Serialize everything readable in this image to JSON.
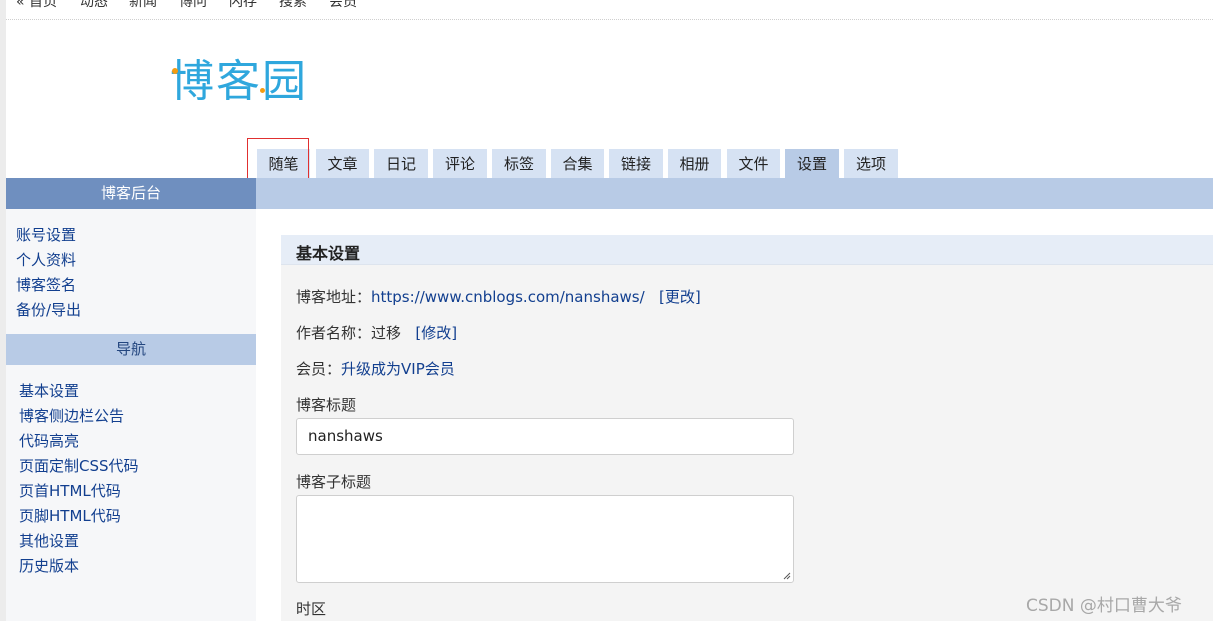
{
  "topnav": {
    "items": [
      "« 首页",
      "动态",
      "新闻",
      "博问",
      "闪存",
      "搜索",
      "会员"
    ]
  },
  "logo": {
    "text": "博客园"
  },
  "tabs": [
    "随笔",
    "文章",
    "日记",
    "评论",
    "标签",
    "合集",
    "链接",
    "相册",
    "文件",
    "设置",
    "选项"
  ],
  "active_tab": "设置",
  "sidebar": {
    "title": "博客后台",
    "account_links": [
      "账号设置",
      "个人资料",
      "博客签名",
      "备份/导出"
    ],
    "nav_title": "导航",
    "nav_links": [
      "基本设置",
      "博客侧边栏公告",
      "代码高亮",
      "页面定制CSS代码",
      "页首HTML代码",
      "页脚HTML代码",
      "其他设置",
      "历史版本"
    ]
  },
  "main": {
    "section_title": "基本设置",
    "blog_url_label": "博客地址：",
    "blog_url": "https://www.cnblogs.com/nanshaws/",
    "change_link": "[更改]",
    "author_label": "作者名称：",
    "author_name": "过移",
    "modify_link": "[修改]",
    "member_label": "会员：",
    "member_link": "升级成为VIP会员",
    "title_label": "博客标题",
    "title_value": "nanshaws",
    "subtitle_label": "博客子标题",
    "subtitle_value": "",
    "timezone_label": "时区"
  },
  "watermark": "CSDN @村口曹大爷",
  "colors": {
    "tab_bg": "#d6e2f3",
    "tab_active_bg": "#b8cbe6",
    "band": "#b8cbe6",
    "sidebar_title_bg": "#6f8fbf",
    "link": "#123f8f",
    "logo": "#2fa7dd",
    "highlight_box": "#e03030"
  }
}
